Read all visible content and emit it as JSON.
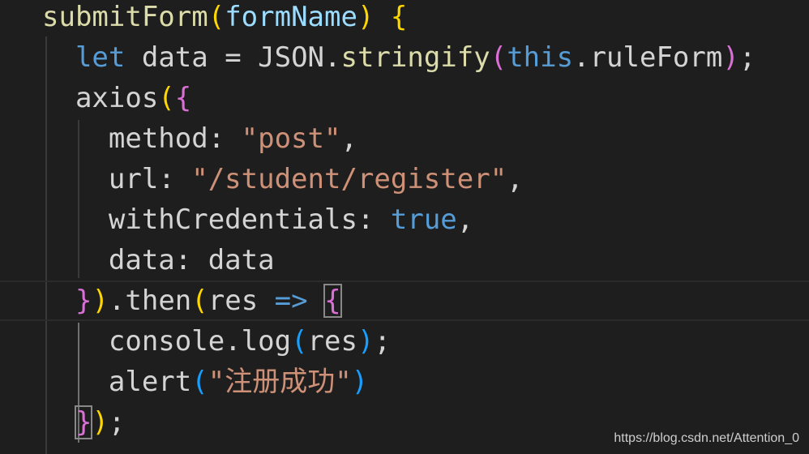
{
  "editor": {
    "lines": [
      [
        {
          "t": "submitForm",
          "c": "fn"
        },
        {
          "t": "(",
          "c": "b1"
        },
        {
          "t": "formName",
          "c": "param"
        },
        {
          "t": ")",
          "c": "b1"
        },
        {
          "t": " ",
          "c": "plain"
        },
        {
          "t": "{",
          "c": "b1"
        }
      ],
      [
        {
          "t": "  ",
          "c": "plain"
        },
        {
          "t": "let",
          "c": "kw"
        },
        {
          "t": " data = JSON.",
          "c": "plain"
        },
        {
          "t": "stringify",
          "c": "fn"
        },
        {
          "t": "(",
          "c": "b2"
        },
        {
          "t": "this",
          "c": "kw"
        },
        {
          "t": ".ruleForm",
          "c": "plain"
        },
        {
          "t": ")",
          "c": "b2"
        },
        {
          "t": ";",
          "c": "plain"
        }
      ],
      [
        {
          "t": "  axios",
          "c": "plain"
        },
        {
          "t": "(",
          "c": "b1"
        },
        {
          "t": "{",
          "c": "b2"
        }
      ],
      [
        {
          "t": "    method: ",
          "c": "plain"
        },
        {
          "t": "\"post\"",
          "c": "str"
        },
        {
          "t": ",",
          "c": "plain"
        }
      ],
      [
        {
          "t": "    url: ",
          "c": "plain"
        },
        {
          "t": "\"/student/register\"",
          "c": "str"
        },
        {
          "t": ",",
          "c": "plain"
        }
      ],
      [
        {
          "t": "    withCredentials: ",
          "c": "plain"
        },
        {
          "t": "true",
          "c": "kw"
        },
        {
          "t": ",",
          "c": "plain"
        }
      ],
      [
        {
          "t": "    data: data",
          "c": "plain"
        }
      ],
      [
        {
          "t": "  ",
          "c": "plain"
        },
        {
          "t": "}",
          "c": "b2"
        },
        {
          "t": ")",
          "c": "b1"
        },
        {
          "t": ".then",
          "c": "plain"
        },
        {
          "t": "(",
          "c": "b1"
        },
        {
          "t": "res ",
          "c": "plain"
        },
        {
          "t": "=>",
          "c": "kw"
        },
        {
          "t": " ",
          "c": "plain"
        },
        {
          "t": "{",
          "c": "b2",
          "match": true
        }
      ],
      [
        {
          "t": "    console.",
          "c": "plain"
        },
        {
          "t": "log",
          "c": "plain"
        },
        {
          "t": "(",
          "c": "b3"
        },
        {
          "t": "res",
          "c": "plain"
        },
        {
          "t": ")",
          "c": "b3"
        },
        {
          "t": ";",
          "c": "plain"
        }
      ],
      [
        {
          "t": "    alert",
          "c": "plain"
        },
        {
          "t": "(",
          "c": "b3"
        },
        {
          "t": "\"注册成功\"",
          "c": "str"
        },
        {
          "t": ")",
          "c": "b3"
        }
      ],
      [
        {
          "t": "  ",
          "c": "plain"
        },
        {
          "t": "}",
          "c": "b2",
          "match": true
        },
        {
          "t": ")",
          "c": "b1"
        },
        {
          "t": ";",
          "c": "plain"
        }
      ]
    ],
    "current_line_index": 7
  },
  "watermark": "https://blog.csdn.net/Attention_0"
}
